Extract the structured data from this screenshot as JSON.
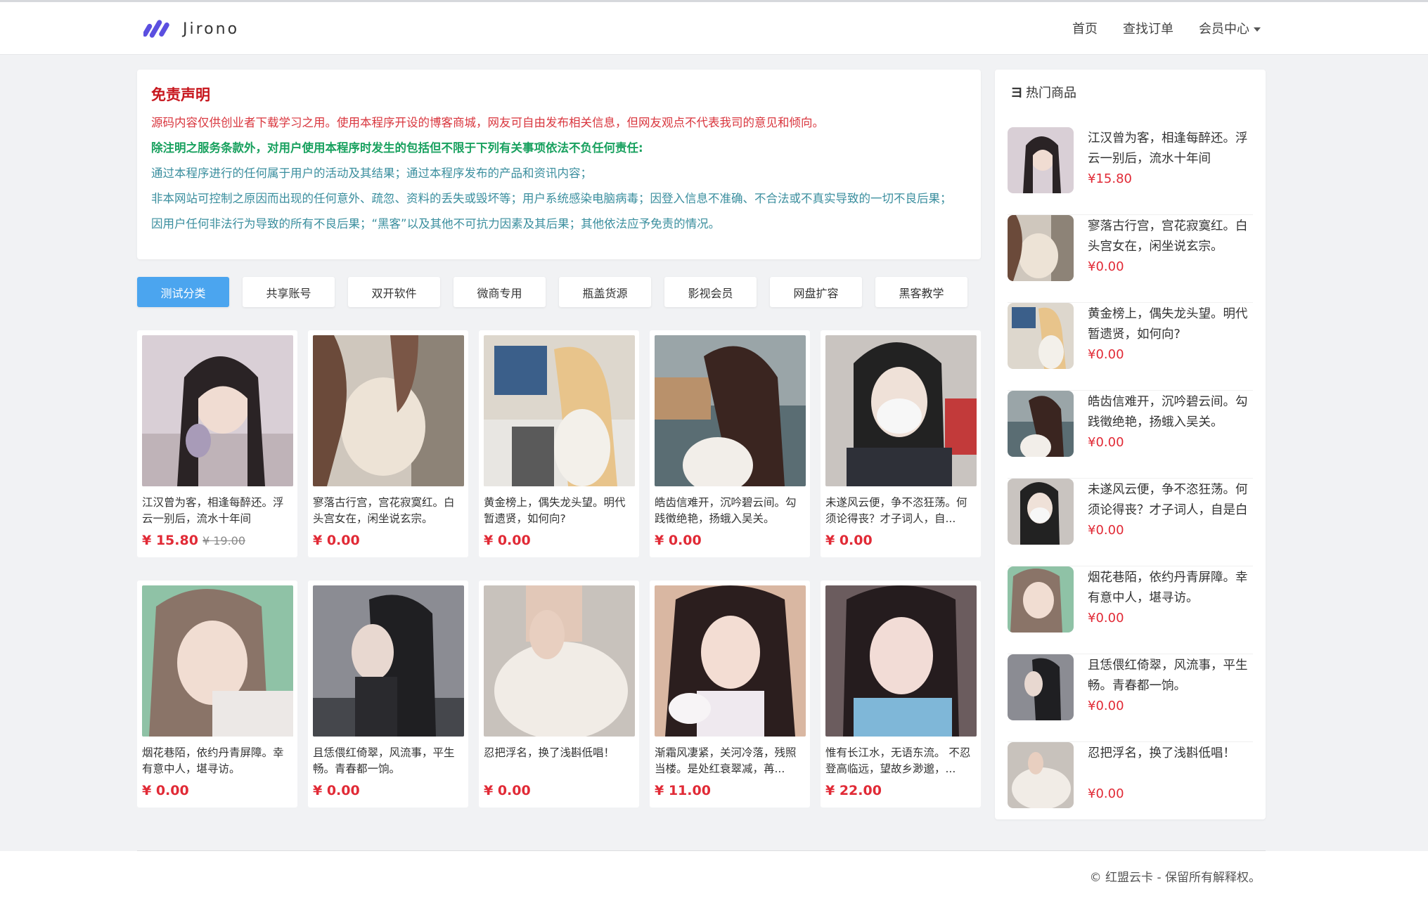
{
  "brand": {
    "name": "Jirono",
    "accent": "#5b4fe0"
  },
  "nav": {
    "home": "首页",
    "orders": "查找订单",
    "member": "会员中心"
  },
  "disclaimer": {
    "title": "免责声明",
    "line1": "源码内容仅供创业者下载学习之用。使用本程序开设的博客商城，网友可自由发布相关信息，但网友观点不代表我司的意见和倾向。",
    "line2": "除注明之服务条款外，对用户使用本程序时发生的包括但不限于下列有关事项依法不负任何责任:",
    "line3": "通过本程序进行的任何属于用户的活动及其结果；通过本程序发布的产品和资讯内容；",
    "line4": "非本网站可控制之原因而出现的任何意外、疏忽、资料的丢失或毁坏等；用户系统感染电脑病毒；因登入信息不准确、不合法或不真实导致的一切不良后果；",
    "line5": "因用户任何非法行为导致的所有不良后果；“黑客”以及其他不可抗力因素及其后果；其他依法应予免责的情况。"
  },
  "tabs": [
    "测试分类",
    "共享账号",
    "双开软件",
    "微商专用",
    "瓶盖货源",
    "影视会员",
    "网盘扩容",
    "黑客教学"
  ],
  "products": [
    {
      "desc": "江汉曾为客，相逢每醉还。浮云一别后，流水十年间",
      "price": "¥ 15.80",
      "old": "¥ 19.00"
    },
    {
      "desc": "寥落古行宫，宫花寂寞红。白头宫女在，闲坐说玄宗。",
      "price": "¥ 0.00",
      "old": ""
    },
    {
      "desc": "黄金榜上，偶失龙头望。明代暂遗贤，如何向?",
      "price": "¥ 0.00",
      "old": ""
    },
    {
      "desc": "皓齿信难开，沉吟碧云间。勾践徵绝艳，扬蛾入吴关。",
      "price": "¥ 0.00",
      "old": ""
    },
    {
      "desc": "未遂风云便，争不恣狂荡。何须论得丧？才子词人，自...",
      "price": "¥ 0.00",
      "old": ""
    },
    {
      "desc": "烟花巷陌，依约丹青屏障。幸有意中人，堪寻访。",
      "price": "¥ 0.00",
      "old": ""
    },
    {
      "desc": "且恁偎红倚翠，风流事，平生畅。青春都一饷。",
      "price": "¥ 0.00",
      "old": ""
    },
    {
      "desc": "忍把浮名，换了浅斟低唱！",
      "price": "¥ 0.00",
      "old": ""
    },
    {
      "desc": "渐霜风凄紧，关河冷落，残照当楼。是处红衰翠减，苒...",
      "price": "¥ 11.00",
      "old": ""
    },
    {
      "desc": "惟有长江水，无语东流。 不忍登高临远，望故乡渺邈，...",
      "price": "¥ 22.00",
      "old": ""
    }
  ],
  "sidebar": {
    "title": "热门商品",
    "items": [
      {
        "desc": "江汉曾为客，相逢每醉还。浮云一别后，流水十年间",
        "price": "¥15.80"
      },
      {
        "desc": "寥落古行宫，宫花寂寞红。白头宫女在，闲坐说玄宗。",
        "price": "¥0.00"
      },
      {
        "desc": "黄金榜上，偶失龙头望。明代暂遗贤，如何向?",
        "price": "¥0.00"
      },
      {
        "desc": "皓齿信难开，沉吟碧云间。勾践徵绝艳，扬蛾入吴关。",
        "price": "¥0.00"
      },
      {
        "desc": "未遂风云便，争不恣狂荡。何须论得丧？才子词人，自是白",
        "price": "¥0.00"
      },
      {
        "desc": "烟花巷陌，依约丹青屏障。幸有意中人，堪寻访。",
        "price": "¥0.00"
      },
      {
        "desc": "且恁偎红倚翠，风流事，平生畅。青春都一饷。",
        "price": "¥0.00"
      },
      {
        "desc": "忍把浮名，换了浅斟低唱！",
        "price": "¥0.00"
      }
    ]
  },
  "footer": {
    "text": "© 红盟云卡 - 保留所有解释权。"
  }
}
